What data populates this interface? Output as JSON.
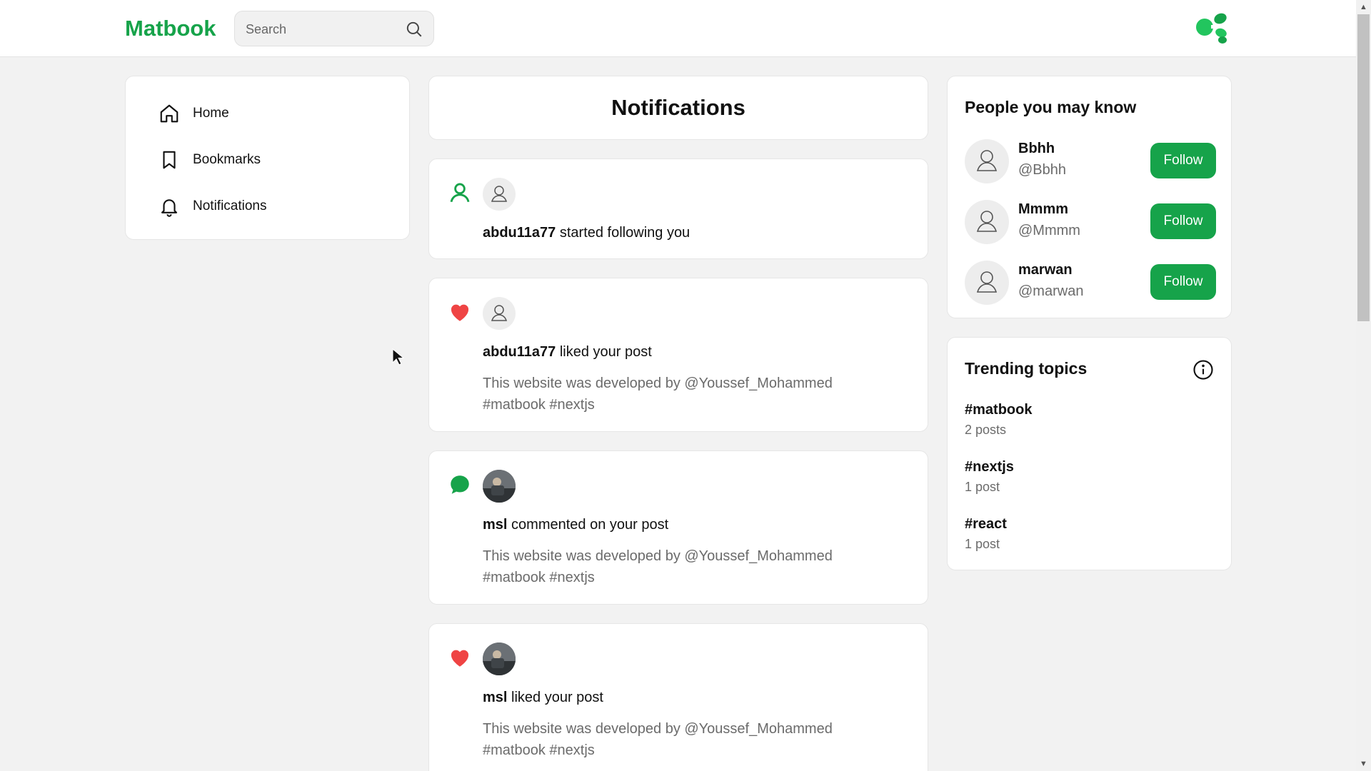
{
  "header": {
    "logo": "Matbook",
    "search_placeholder": "Search"
  },
  "nav": {
    "items": [
      {
        "label": "Home",
        "icon": "home-icon"
      },
      {
        "label": "Bookmarks",
        "icon": "bookmark-icon"
      },
      {
        "label": "Notifications",
        "icon": "bell-icon"
      }
    ]
  },
  "main": {
    "title": "Notifications",
    "notifications": [
      {
        "type": "follow",
        "icon": "user-follow-icon",
        "user": "abdu11a77",
        "action": "started following you",
        "post": ""
      },
      {
        "type": "like",
        "icon": "heart-icon",
        "user": "abdu11a77",
        "action": "liked your post",
        "post": "This website was developed by @Youssef_Mohammed #matbook #nextjs"
      },
      {
        "type": "comment",
        "icon": "comment-icon",
        "user": "msl",
        "action": "commented on your post",
        "post": "This website was developed by @Youssef_Mohammed #matbook #nextjs"
      },
      {
        "type": "like",
        "icon": "heart-icon",
        "user": "msl",
        "action": "liked your post",
        "post": "This website was developed by @Youssef_Mohammed #matbook #nextjs"
      }
    ]
  },
  "people": {
    "title": "People you may know",
    "users": [
      {
        "name": "Bbhh",
        "handle": "@Bbhh",
        "button": "Follow"
      },
      {
        "name": "Mmmm",
        "handle": "@Mmmm",
        "button": "Follow"
      },
      {
        "name": "marwan",
        "handle": "@marwan",
        "button": "Follow"
      }
    ]
  },
  "trending": {
    "title": "Trending topics",
    "topics": [
      {
        "tag": "#matbook",
        "count": "2 posts"
      },
      {
        "tag": "#nextjs",
        "count": "1 post"
      },
      {
        "tag": "#react",
        "count": "1 post"
      }
    ]
  },
  "colors": {
    "brand": "#16a34a",
    "like": "#ef4444",
    "background": "#f2f2f2"
  }
}
